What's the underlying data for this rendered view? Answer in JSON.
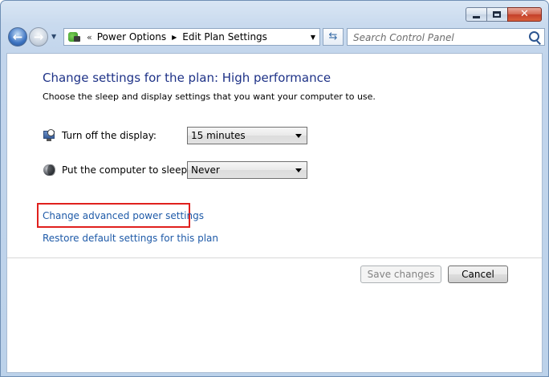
{
  "window": {
    "caption_buttons": {
      "minimize": "minimize-icon",
      "maximize": "maximize-icon",
      "close": "close-icon"
    }
  },
  "navbar": {
    "breadcrumbs": [
      "Power Options",
      "Edit Plan Settings"
    ],
    "overflow_glyph": "«",
    "search_placeholder": "Search Control Panel"
  },
  "main": {
    "heading": "Change settings for the plan: High performance",
    "subtext": "Choose the sleep and display settings that you want your computer to use.",
    "settings": [
      {
        "label": "Turn off the display:",
        "value": "15 minutes",
        "icon": "display-timer-icon"
      },
      {
        "label": "Put the computer to sleep:",
        "value": "Never",
        "icon": "sleep-moon-icon"
      }
    ],
    "links": {
      "advanced": "Change advanced power settings",
      "restore": "Restore default settings for this plan"
    },
    "buttons": {
      "save": "Save changes",
      "cancel": "Cancel"
    }
  },
  "colors": {
    "heading": "#1e3287",
    "link": "#1e5aa8",
    "highlight": "#e0201d",
    "disabled_text": "#838383"
  }
}
